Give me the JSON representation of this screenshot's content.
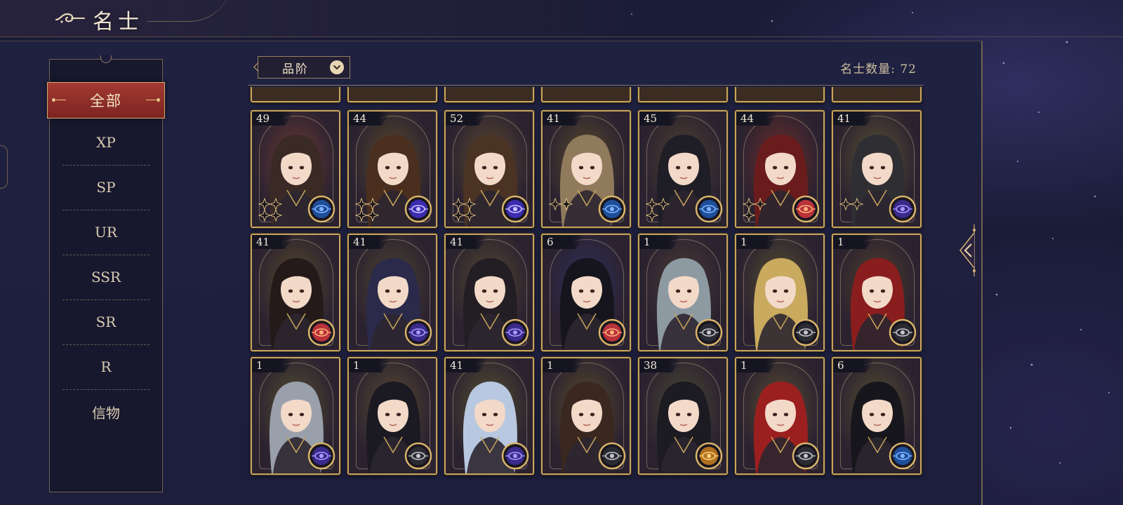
{
  "header": {
    "title": "名士",
    "icon": "cloud-swirl-icon"
  },
  "filter": {
    "label": "品阶",
    "icon": "chevron-down-icon"
  },
  "count": {
    "text": "名士数量: 72"
  },
  "sidebar": {
    "items": [
      {
        "label": "全部",
        "active": true
      },
      {
        "label": "XP"
      },
      {
        "label": "SP"
      },
      {
        "label": "UR"
      },
      {
        "label": "SSR"
      },
      {
        "label": "SR"
      },
      {
        "label": "R"
      },
      {
        "label": "信物"
      }
    ]
  },
  "colors": {
    "gold": "#c8a45d",
    "active_red": "#a23a32",
    "panel": "#1f2140",
    "text_light": "#efe6d2"
  },
  "cards": [
    {
      "level": "49",
      "theme": "#6b3a33",
      "hair": "#3a2a26",
      "element": "blue",
      "stars": 4
    },
    {
      "level": "44",
      "theme": "#5b4a2b",
      "hair": "#4a2f1e",
      "element": "purple-orb",
      "stars": 4
    },
    {
      "level": "52",
      "theme": "#5d4a2e",
      "hair": "#4b3324",
      "element": "purple-orb",
      "stars": 4
    },
    {
      "level": "41",
      "theme": "#5a4a2c",
      "hair": "#8f7a5c",
      "element": "blue",
      "stars": 2
    },
    {
      "level": "45",
      "theme": "#4f4330",
      "hair": "#1f1d26",
      "element": "blue",
      "stars": 3
    },
    {
      "level": "44",
      "theme": "#6d2f2a",
      "hair": "#6a1c1c",
      "element": "red",
      "stars": 3
    },
    {
      "level": "41",
      "theme": "#5b5332",
      "hair": "#2f2e33",
      "element": "purple",
      "stars": 2
    },
    {
      "level": "41",
      "theme": "#5a4a2c",
      "hair": "#241a19",
      "element": "red",
      "stars": 0
    },
    {
      "level": "41",
      "theme": "#4e4530",
      "hair": "#2b2a4a",
      "element": "purple",
      "stars": 0
    },
    {
      "level": "41",
      "theme": "#544a31",
      "hair": "#231e24",
      "element": "purple",
      "stars": 0
    },
    {
      "level": "6",
      "theme": "#2e2f5a",
      "hair": "#16151d",
      "element": "red",
      "stars": 0
    },
    {
      "level": "1",
      "theme": "#4b3c35",
      "hair": "#8d9aa2",
      "element": "gray",
      "stars": 0
    },
    {
      "level": "1",
      "theme": "#57512f",
      "hair": "#c9aa5e",
      "element": "gray",
      "stars": 0
    },
    {
      "level": "1",
      "theme": "#503e2c",
      "hair": "#8a1d1d",
      "element": "gray",
      "stars": 0
    },
    {
      "level": "1",
      "theme": "#565030",
      "hair": "#9aa0ab",
      "element": "purple",
      "stars": 0
    },
    {
      "level": "1",
      "theme": "#5a4d30",
      "hair": "#1b1a22",
      "element": "gray",
      "stars": 0
    },
    {
      "level": "41",
      "theme": "#58532f",
      "hair": "#b8c8e0",
      "element": "purple",
      "stars": 0
    },
    {
      "level": "1",
      "theme": "#5a4a2c",
      "hair": "#3a2820",
      "element": "gray",
      "stars": 0
    },
    {
      "level": "38",
      "theme": "#4a4a33",
      "hair": "#1c1b22",
      "element": "orange",
      "stars": 0
    },
    {
      "level": "1",
      "theme": "#5a4d30",
      "hair": "#9b1f1f",
      "element": "gray",
      "stars": 0
    },
    {
      "level": "6",
      "theme": "#55502f",
      "hair": "#17161c",
      "element": "blue",
      "stars": 0
    }
  ]
}
